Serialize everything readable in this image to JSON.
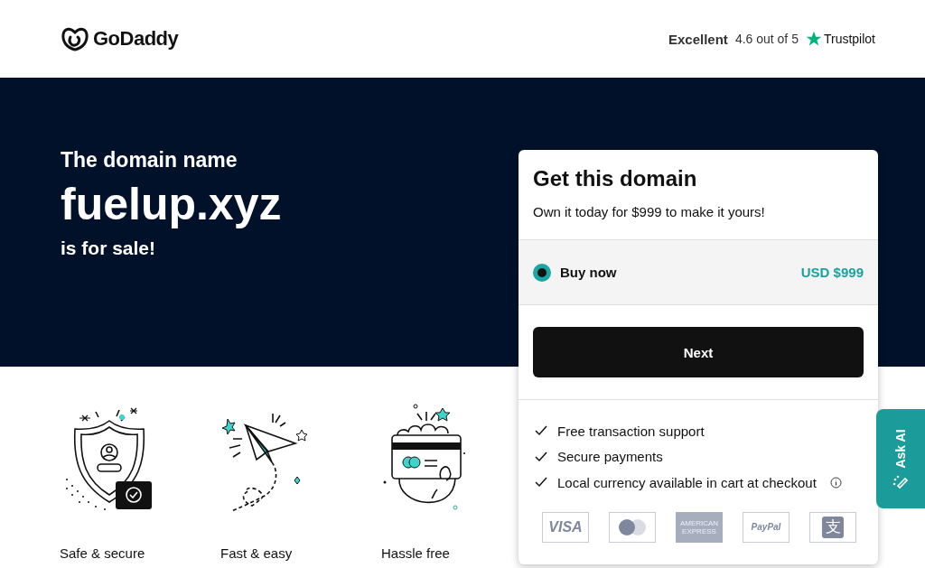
{
  "header": {
    "logo": "GoDaddy",
    "rating": {
      "label": "Excellent",
      "score": "4.6 out of 5",
      "brand": "Trustpilot"
    }
  },
  "hero": {
    "intro": "The domain name",
    "domain": "fuelup.xyz",
    "outro": "is for sale!"
  },
  "features": [
    {
      "kind": "shield",
      "label": "Safe & secure"
    },
    {
      "kind": "plane",
      "label": "Fast & easy"
    },
    {
      "kind": "card",
      "label": "Hassle free"
    }
  ],
  "offer": {
    "title": "Get this domain",
    "subtitle": "Own it today for $999 to make it yours!",
    "options": [
      {
        "label": "Buy now",
        "price": "USD $999",
        "selected": true
      }
    ],
    "button": "Next",
    "benefits": [
      {
        "text": "Free transaction support",
        "info": false
      },
      {
        "text": "Secure payments",
        "info": false
      },
      {
        "text": "Local currency available in cart at checkout",
        "info": true
      }
    ],
    "payment_methods": [
      {
        "kind": "visa",
        "text": "VISA"
      },
      {
        "kind": "mastercard"
      },
      {
        "kind": "amex",
        "text": "AMERICAN EXPRESS"
      },
      {
        "kind": "paypal",
        "text": "PayPal"
      },
      {
        "kind": "alipay",
        "text": "支"
      }
    ]
  },
  "assistant": {
    "label": "Ask AI"
  }
}
